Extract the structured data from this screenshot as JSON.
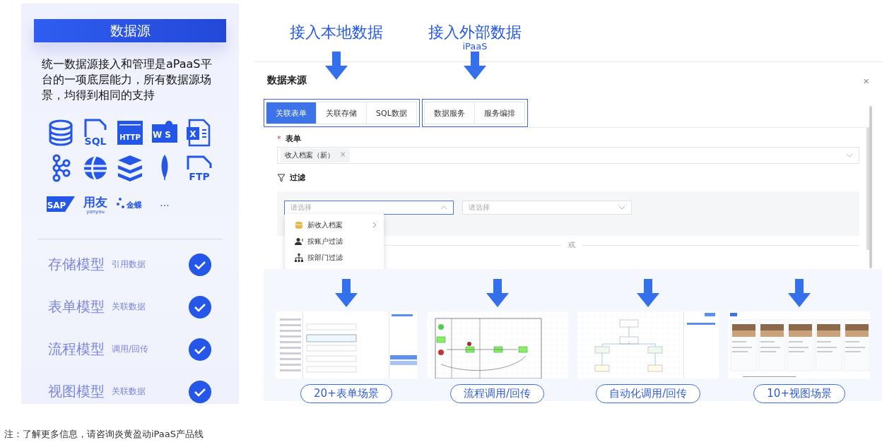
{
  "source_panel": {
    "title": "数据源",
    "description": "统一数据源接入和管理是aPaaS平台的一项底层能力，所有数据源场景，均得到相同的支持",
    "sources": [
      {
        "kind": "database"
      },
      {
        "kind": "sql",
        "label": "SQL"
      },
      {
        "kind": "http",
        "label": "HTTP"
      },
      {
        "kind": "webservice",
        "label": "WS"
      },
      {
        "kind": "excel",
        "label": "X"
      },
      {
        "kind": "graph"
      },
      {
        "kind": "globe"
      },
      {
        "kind": "stack"
      },
      {
        "kind": "leaf"
      },
      {
        "kind": "ftp",
        "label": "FTP"
      },
      {
        "kind": "sap",
        "label": "SAP"
      },
      {
        "kind": "yonyou",
        "label": "用友",
        "sublabel": "yonyou"
      },
      {
        "kind": "kingdee",
        "label": "金蝶"
      },
      {
        "kind": "more",
        "label": "..."
      }
    ],
    "models": [
      {
        "name": "存储模型",
        "note": "引用数据",
        "checked": true
      },
      {
        "name": "表单模型",
        "note": "关联数据",
        "checked": true
      },
      {
        "name": "流程模型",
        "note": "调用/回传",
        "checked": true
      },
      {
        "name": "视图模型",
        "note": "关联数据",
        "checked": true
      }
    ]
  },
  "access_headings": [
    {
      "title": "接入本地数据"
    },
    {
      "title": "接入外部数据",
      "subtitle": "iPaaS"
    }
  ],
  "dialog": {
    "title": "数据来源",
    "close": "×",
    "tab_groups": [
      [
        {
          "label": "关联表单",
          "selected": true
        },
        {
          "label": "关联存储",
          "selected": false
        },
        {
          "label": "SQL数据",
          "selected": false
        }
      ],
      [
        {
          "label": "数据服务",
          "selected": false
        },
        {
          "label": "服务编排",
          "selected": false
        }
      ]
    ],
    "form_field": {
      "label": "表单",
      "required": true,
      "required_mark": "*",
      "tags": [
        {
          "label": "收入档案（新）",
          "remove": "×"
        }
      ]
    },
    "filter": {
      "label": "过滤",
      "selects": [
        {
          "placeholder": "请选择",
          "open": true
        },
        {
          "placeholder": "请选择",
          "open": false
        }
      ],
      "menu": [
        {
          "label": "新收入档案",
          "kind": "database",
          "submenu": true
        },
        {
          "label": "按账户过滤",
          "kind": "user",
          "submenu": false
        },
        {
          "label": "按部门过滤",
          "kind": "org",
          "submenu": false
        }
      ],
      "divider": "或"
    }
  },
  "scenarios": [
    {
      "kind": "form",
      "label": "20+表单场景"
    },
    {
      "kind": "flow",
      "label": "流程调用/回传"
    },
    {
      "kind": "automation",
      "label": "自动化调用/回传"
    },
    {
      "kind": "cards",
      "label": "10+视图场景"
    }
  ],
  "footer_note": "注：了解更多信息，请咨询炎黄盈动iPaaS产品线"
}
